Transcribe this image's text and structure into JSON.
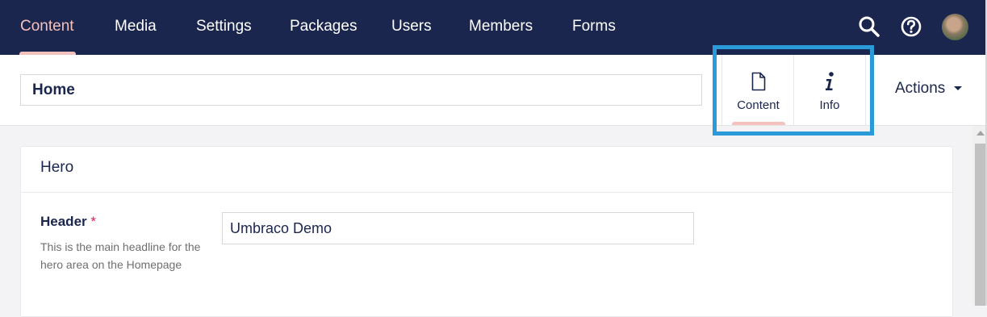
{
  "nav": {
    "items": [
      {
        "label": "Content",
        "active": true
      },
      {
        "label": "Media"
      },
      {
        "label": "Settings"
      },
      {
        "label": "Packages"
      },
      {
        "label": "Users"
      },
      {
        "label": "Members"
      },
      {
        "label": "Forms"
      }
    ],
    "icons": [
      "search-icon",
      "help-icon",
      "avatar"
    ]
  },
  "editor": {
    "name_value": "Home",
    "apps": [
      {
        "label": "Content",
        "icon": "document-icon",
        "active": true
      },
      {
        "label": "Info",
        "icon": "info-icon"
      }
    ],
    "actions_label": "Actions"
  },
  "group": {
    "title": "Hero",
    "property": {
      "label": "Header",
      "required_mark": "*",
      "description": "This is the main headline for the hero area on the Homepage",
      "value": "Umbraco Demo"
    }
  },
  "colors": {
    "nav_bg": "#1b264f",
    "accent": "#f5c1bc",
    "highlight": "#2a9ad8",
    "required": "#d42054"
  }
}
